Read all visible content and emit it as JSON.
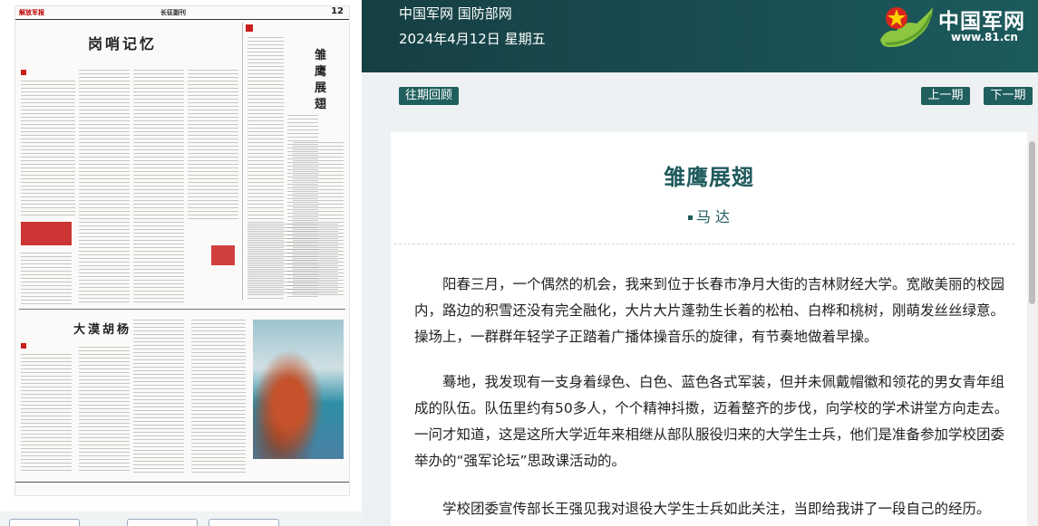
{
  "header": {
    "site_name": "中国军网 国防部网",
    "date": "2024年4月12日 星期五",
    "logo_text": "中国军网",
    "logo_url": "www.81.cn"
  },
  "nav": {
    "archive_label": "往期回顾",
    "prev_label": "上一期",
    "next_label": "下一期"
  },
  "newspaper": {
    "masthead": "解放军报",
    "section": "长征副刊",
    "page_number": "12",
    "headline_left": "岗哨记忆",
    "headline_bottom": "大漠胡杨",
    "headline_right": "雏鹰展翅"
  },
  "article": {
    "title": "雏鹰展翅",
    "author": "马 达",
    "paragraphs": [
      "阳春三月，一个偶然的机会，我来到位于长春市净月大街的吉林财经大学。宽敞美丽的校园内，路边的积雪还没有完全融化，大片大片蓬勃生长着的松柏、白桦和桃树，刚萌发丝丝绿意。操场上，一群群年轻学子正踏着广播体操音乐的旋律，有节奏地做着早操。",
      "蓦地，我发现有一支身着绿色、白色、蓝色各式军装，但并未佩戴帽徽和领花的男女青年组成的队伍。队伍里约有50多人，个个精神抖擞，迈着整齐的步伐，向学校的学术讲堂方向走去。一问才知道，这是这所大学近年来相继从部队服役归来的大学生士兵，他们是准备参加学校团委举办的“强军论坛”思政课活动的。",
      "学校团委宣传部长王强见我对退役大学生士兵如此关注，当即给我讲了一段自己的经历。"
    ]
  },
  "colors": {
    "header_bg": "#1c5a5c",
    "accent": "#1f5b5c",
    "button_bg": "#1f5f5e"
  }
}
